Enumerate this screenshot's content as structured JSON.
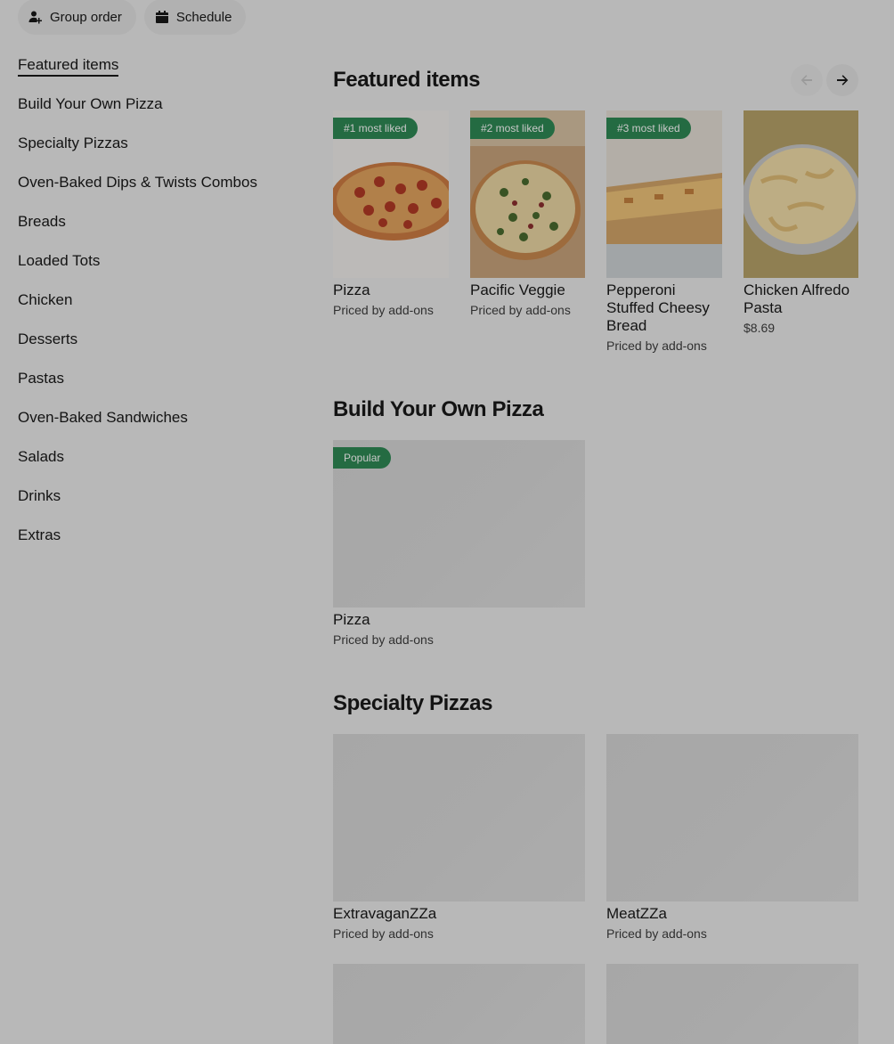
{
  "topbar": {
    "group_order_label": "Group order",
    "schedule_label": "Schedule"
  },
  "sidebar": {
    "items": [
      {
        "label": "Featured items",
        "active": true
      },
      {
        "label": "Build Your Own Pizza"
      },
      {
        "label": "Specialty Pizzas"
      },
      {
        "label": "Oven-Baked Dips & Twists Combos"
      },
      {
        "label": "Breads"
      },
      {
        "label": "Loaded Tots"
      },
      {
        "label": "Chicken"
      },
      {
        "label": "Desserts"
      },
      {
        "label": "Pastas"
      },
      {
        "label": "Oven-Baked Sandwiches"
      },
      {
        "label": "Salads"
      },
      {
        "label": "Drinks"
      },
      {
        "label": "Extras"
      }
    ]
  },
  "featured": {
    "title": "Featured items",
    "items": [
      {
        "badge": "#1 most liked",
        "name": "Pizza",
        "price": "Priced by add-ons",
        "image": "pepperoni-pizza"
      },
      {
        "badge": "#2 most liked",
        "name": "Pacific Veggie",
        "price": "Priced by add-ons",
        "image": "veggie-pizza"
      },
      {
        "badge": "#3 most liked",
        "name": "Pepperoni Stuffed Cheesy Bread",
        "price": "Priced by add-ons",
        "image": "cheesy-bread"
      },
      {
        "badge": "",
        "name": "Chicken Alfredo Pasta",
        "price": "$8.69",
        "image": "alfredo-pasta"
      }
    ]
  },
  "byo": {
    "title": "Build Your Own Pizza",
    "items": [
      {
        "badge": "Popular",
        "name": "Pizza",
        "price": "Priced by add-ons"
      }
    ]
  },
  "specialty": {
    "title": "Specialty Pizzas",
    "items": [
      {
        "name": "ExtravaganZZa",
        "price": "Priced by add-ons"
      },
      {
        "name": "MeatZZa",
        "price": "Priced by add-ons"
      }
    ]
  },
  "colors": {
    "badge_green": "#2f8a55",
    "background": "#ececec"
  },
  "icons": [
    "person-add-icon",
    "calendar-icon",
    "arrow-left-icon",
    "arrow-right-icon"
  ]
}
